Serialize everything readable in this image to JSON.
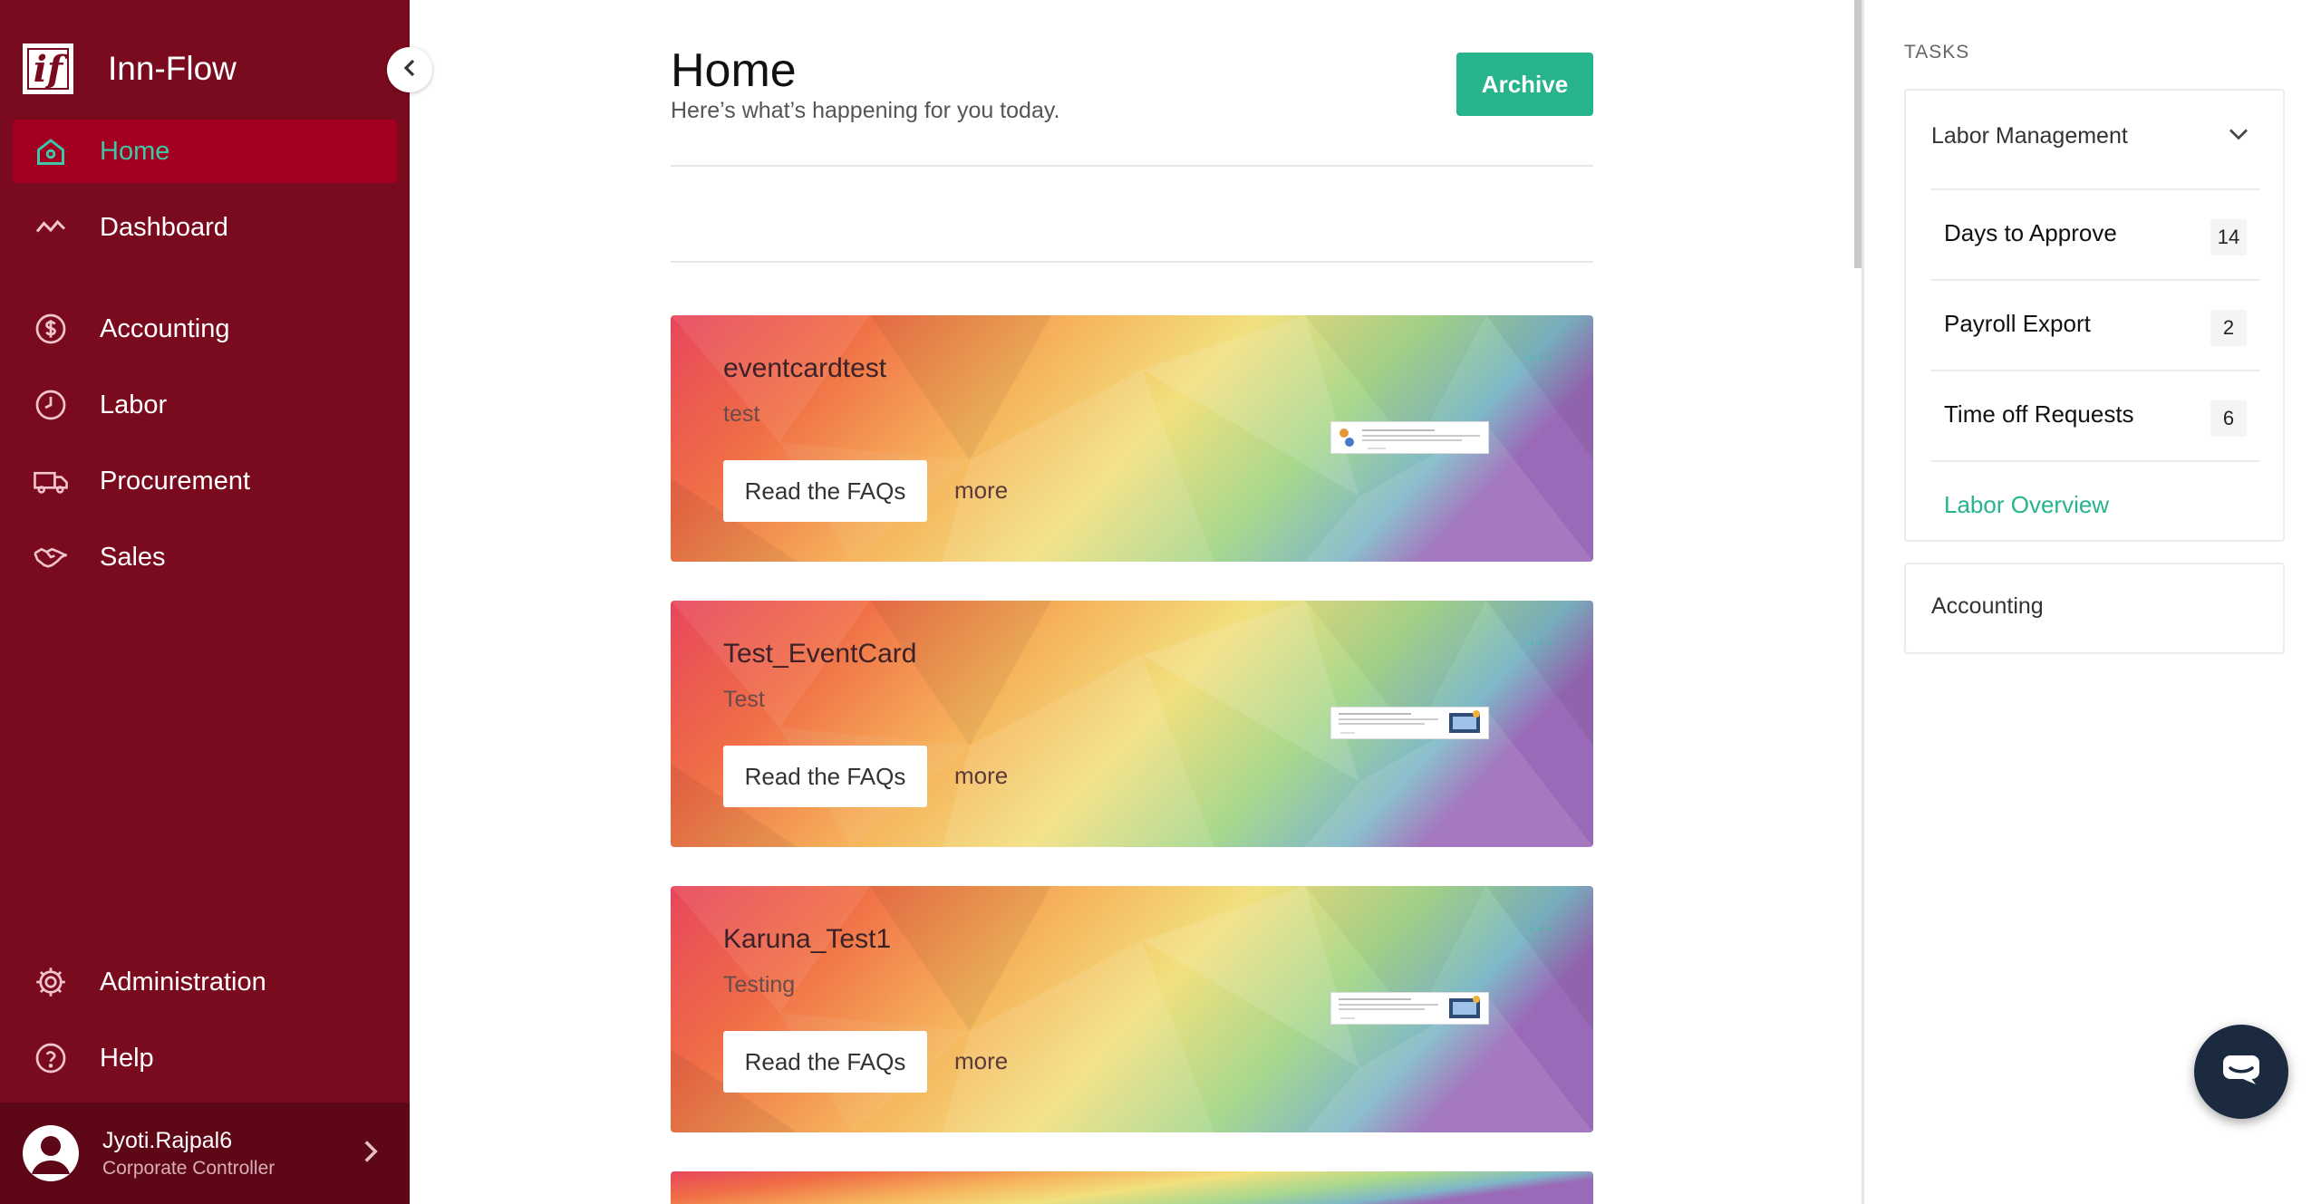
{
  "app": {
    "name": "Inn-Flow",
    "logo_text": "if"
  },
  "sidebar": {
    "items": [
      {
        "label": "Home",
        "icon": "home-icon",
        "active": true
      },
      {
        "label": "Dashboard",
        "icon": "trend-line-icon"
      },
      {
        "label": "Accounting",
        "icon": "dollar-circle-icon"
      },
      {
        "label": "Labor",
        "icon": "clock-icon"
      },
      {
        "label": "Procurement",
        "icon": "truck-icon"
      },
      {
        "label": "Sales",
        "icon": "handshake-icon"
      }
    ],
    "bottom_items": [
      {
        "label": "Administration",
        "icon": "gear-icon"
      },
      {
        "label": "Help",
        "icon": "question-circle-icon"
      }
    ],
    "user": {
      "name": "Jyoti.Rajpal6",
      "role": "Corporate Controller"
    }
  },
  "main": {
    "title": "Home",
    "subtitle": "Here’s what’s happening for you today.",
    "archive_label": "Archive",
    "cards": [
      {
        "title": "eventcardtest",
        "subtitle": "test",
        "button_label": "Read the FAQs",
        "more_label": "more",
        "menu": "···"
      },
      {
        "title": "Test_EventCard",
        "subtitle": "Test",
        "button_label": "Read the FAQs",
        "more_label": "more",
        "menu": "···"
      },
      {
        "title": "Karuna_Test1",
        "subtitle": "Testing",
        "button_label": "Read the FAQs",
        "more_label": "more",
        "menu": "···"
      }
    ]
  },
  "tasks": {
    "heading": "TASKS",
    "labor_group": {
      "title": "Labor Management",
      "rows": [
        {
          "label": "Days to Approve",
          "count": "14"
        },
        {
          "label": "Payroll Export",
          "count": "2"
        },
        {
          "label": "Time off Requests",
          "count": "6"
        }
      ],
      "link": "Labor Overview"
    },
    "accounting_group": {
      "title": "Accounting"
    }
  },
  "colors": {
    "sidebar_bg": "#7a0a1e",
    "active_bg": "#a30021",
    "accent_green": "#27b48d",
    "user_bar_bg": "#5e0716",
    "chat_bg": "#1b2a3e"
  }
}
